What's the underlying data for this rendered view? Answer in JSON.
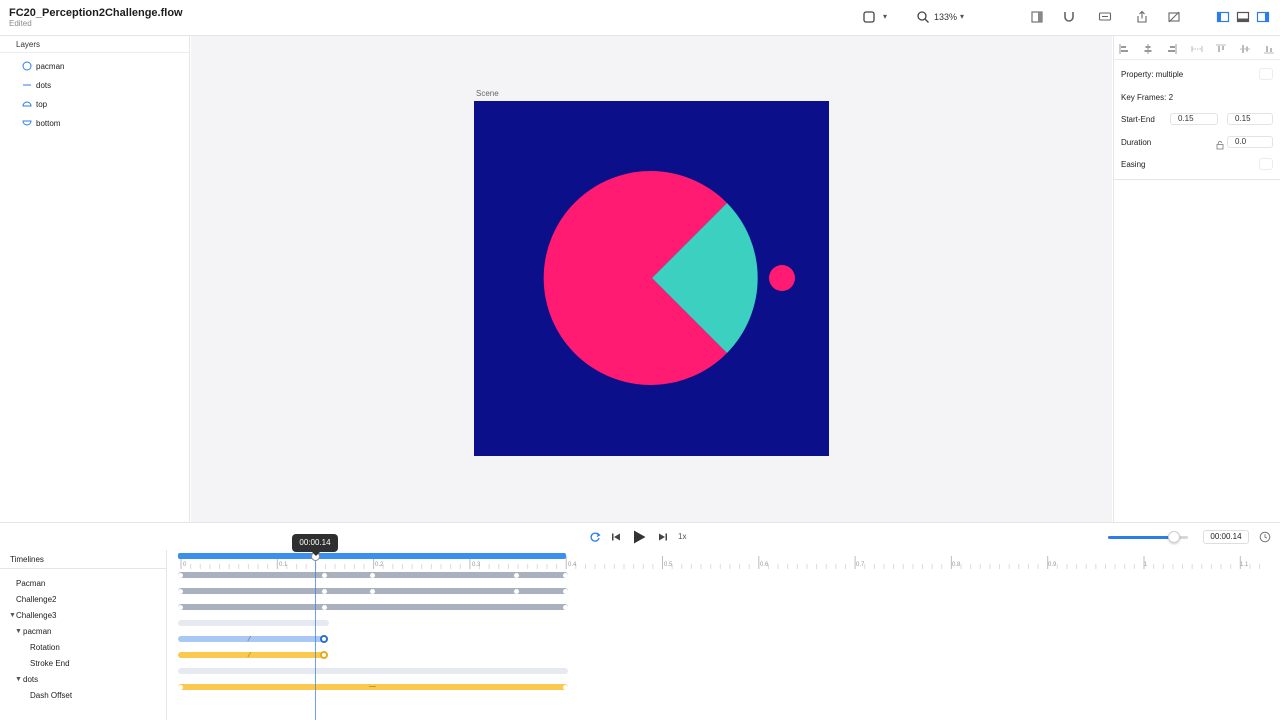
{
  "document": {
    "title": "FC20_Perception2Challenge.flow",
    "status": "Edited"
  },
  "toolbar": {
    "zoom": "133%"
  },
  "layers": {
    "header": "Layers",
    "items": [
      {
        "label": "pacman",
        "icon": "circle-outline-icon"
      },
      {
        "label": "dots",
        "icon": "line-icon"
      },
      {
        "label": "top",
        "icon": "half-circle-top-icon"
      },
      {
        "label": "bottom",
        "icon": "half-circle-bottom-icon"
      }
    ]
  },
  "canvas": {
    "scene_label": "Scene"
  },
  "colors": {
    "scene_bg": "#0b0f8a",
    "pink": "#ff1a72",
    "teal": "#3bd0c0",
    "accent": "#2b7de9",
    "yellow": "#fcc94f",
    "gray_bar": "#a9b1bf"
  },
  "properties": {
    "property": "Property: multiple",
    "keyframes": "Key Frames: 2",
    "start_end_label": "Start-End",
    "start_value": "0.15",
    "end_value": "0.15",
    "duration_label": "Duration",
    "duration_value": "0.0",
    "easing_label": "Easing"
  },
  "playback": {
    "speed": "1x",
    "time": "00:00.14",
    "volume_fraction": 0.82
  },
  "timelines": {
    "header": "Timelines",
    "tooltip": "00:00.14",
    "rows": [
      {
        "label": "Pacman"
      },
      {
        "label": "Challenge2"
      },
      {
        "label": "Challenge3"
      },
      {
        "label": "pacman"
      },
      {
        "label": "Rotation"
      },
      {
        "label": "Stroke End"
      },
      {
        "label": "dots"
      },
      {
        "label": "Dash Offset"
      }
    ],
    "ruler_labels": [
      "0",
      "0.1",
      "0.2",
      "0.3",
      "0.4",
      "0.5",
      "0.6",
      "0.7",
      "0.8",
      "0.9",
      "1",
      "1.1"
    ]
  }
}
